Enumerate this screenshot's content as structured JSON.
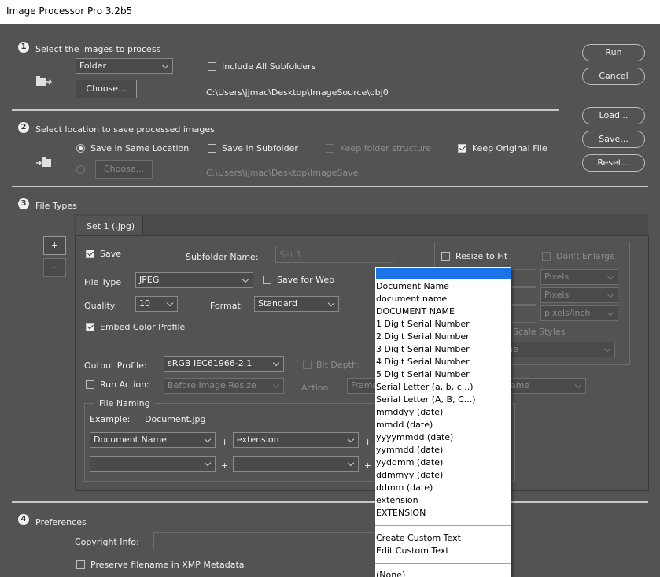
{
  "window": {
    "title": "Image Processor Pro 3.2b5"
  },
  "section1": {
    "number": "1",
    "heading": "Select the images to process",
    "source_select": "Folder",
    "include_subfolders_label": "Include All Subfolders",
    "include_subfolders_checked": false,
    "choose_label": "Choose...",
    "source_path": "C:\\Users\\jjmac\\Desktop\\ImageSource\\obj0"
  },
  "section2": {
    "number": "2",
    "heading": "Select location to save processed images",
    "same_location_label": "Save in Same Location",
    "save_in_subfolder_label": "Save in Subfolder",
    "keep_folder_structure_label": "Keep folder structure",
    "keep_original_label": "Keep Original File",
    "choose_label": "Choose...",
    "save_path": "C:\\Users\\jjmac\\Desktop\\ImageSave"
  },
  "section3": {
    "number": "3",
    "heading": "File Types",
    "add_label": "+",
    "remove_label": "-",
    "tab_label": "Set 1 (.jpg)",
    "save_label": "Save",
    "subfolder_name_label": "Subfolder Name:",
    "subfolder_name_placeholder": "Set 1",
    "file_type_label": "File Type",
    "file_type_value": "JPEG",
    "save_for_web_label": "Save for Web",
    "quality_label": "Quality:",
    "quality_value": "10",
    "format_label": "Format:",
    "format_value": "Standard",
    "embed_color_label": "Embed Color Profile",
    "output_profile_label": "Output Profile:",
    "output_profile_value": "sRGB IEC61966-2.1",
    "bit_depth_label": "Bit Depth:",
    "run_action_label": "Run Action:",
    "run_action_value": "Before Image Resize",
    "action_label": "Action:",
    "action_value": "Frame",
    "action_set_value": "ame",
    "file_naming": {
      "legend": "File Naming",
      "example_label": "Example:",
      "example_value": "Document.jpg",
      "row1_part1": "Document Name",
      "row1_part2": "extension",
      "row2_part1": "",
      "row2_part2": "",
      "plus": "+"
    },
    "resize": {
      "resize_to_fit_label": "Resize to Fit",
      "dont_enlarge_label": "Don't Enlarge",
      "units1": "Pixels",
      "units2": "Pixels",
      "units3": "pixels/inch",
      "scale_styles_label": "Scale Styles",
      "scale_select_value": "ne"
    }
  },
  "section4": {
    "number": "4",
    "heading": "Preferences",
    "copyright_label": "Copyright Info:",
    "preserve_filename_label": "Preserve filename in XMP Metadata"
  },
  "buttons": {
    "run": "Run",
    "cancel": "Cancel",
    "load": "Load...",
    "save": "Save...",
    "reset": "Reset..."
  },
  "dropdown": {
    "items": [
      "Document Name",
      "document name",
      "DOCUMENT NAME",
      "1 Digit Serial Number",
      "2 Digit Serial Number",
      "3 Digit Serial Number",
      "4 Digit Serial Number",
      "5 Digit Serial Number",
      "Serial Letter (a, b, c...)",
      "Serial Letter (A, B, C...)",
      "mmddyy (date)",
      "mmdd (date)",
      "yyyymmdd (date)",
      "yymmdd (date)",
      "yyddmm (date)",
      "ddmmyy (date)",
      "ddmm (date)",
      "extension",
      "EXTENSION"
    ],
    "custom_items": [
      "Create Custom Text",
      "Edit Custom Text"
    ],
    "none_item": "(None)",
    "highlight_color": "#1a73e8"
  }
}
